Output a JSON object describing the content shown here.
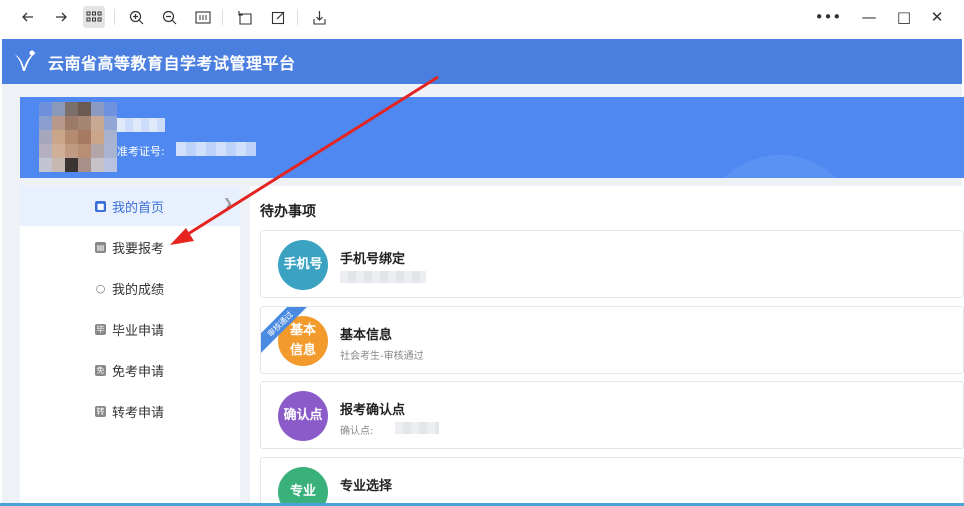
{
  "browser": {
    "back_icon": "arrow-left-icon",
    "forward_icon": "arrow-right-icon",
    "apps_icon": "grid-icon",
    "zoom_in_icon": "zoom-in-icon",
    "zoom_out_icon": "zoom-out-icon",
    "fit_icon": "fit-width-icon",
    "rotate_icon": "rotate-icon",
    "edit_icon": "edit-icon",
    "download_icon": "download-icon",
    "more_label": "•••",
    "minimize_label": "—",
    "maximize_label": "□",
    "close_label": "✕"
  },
  "header": {
    "title": "云南省高等教育自学考试管理平台",
    "accent": "#4a7fe0"
  },
  "profile": {
    "ticket_label": "准考证号:"
  },
  "sidebar": {
    "items": [
      {
        "label": "我的首页",
        "icon": "home-icon",
        "glyph": "■"
      },
      {
        "label": "我要报考",
        "icon": "register-icon",
        "glyph": "▤"
      },
      {
        "label": "我的成绩",
        "icon": "score-icon",
        "glyph": "○"
      },
      {
        "label": "毕业申请",
        "icon": "graduate-icon",
        "glyph": "毕"
      },
      {
        "label": "免考申请",
        "icon": "exempt-icon",
        "glyph": "免"
      },
      {
        "label": "转考申请",
        "icon": "transfer-icon",
        "glyph": "转"
      }
    ],
    "arrow": "❯"
  },
  "main": {
    "section_title": "待办事项",
    "cards": [
      {
        "badge": "手机号",
        "color": "#3aa3c2",
        "title": "手机号绑定",
        "sub": ""
      },
      {
        "badge": "基本\n信息",
        "color": "#f39a2c",
        "title": "基本信息",
        "sub": "社会考生-审核通过",
        "ribbon": "审核通过"
      },
      {
        "badge": "确认点",
        "color": "#8b5cc9",
        "title": "报考确认点",
        "sub": "确认点:"
      },
      {
        "badge": "专业",
        "color": "#3ab07a",
        "title": "专业选择",
        "sub": ""
      }
    ]
  },
  "colors": {
    "banner": "#4f88f0",
    "active_text": "#3b6fd8",
    "annotation_arrow": "#e52421"
  }
}
